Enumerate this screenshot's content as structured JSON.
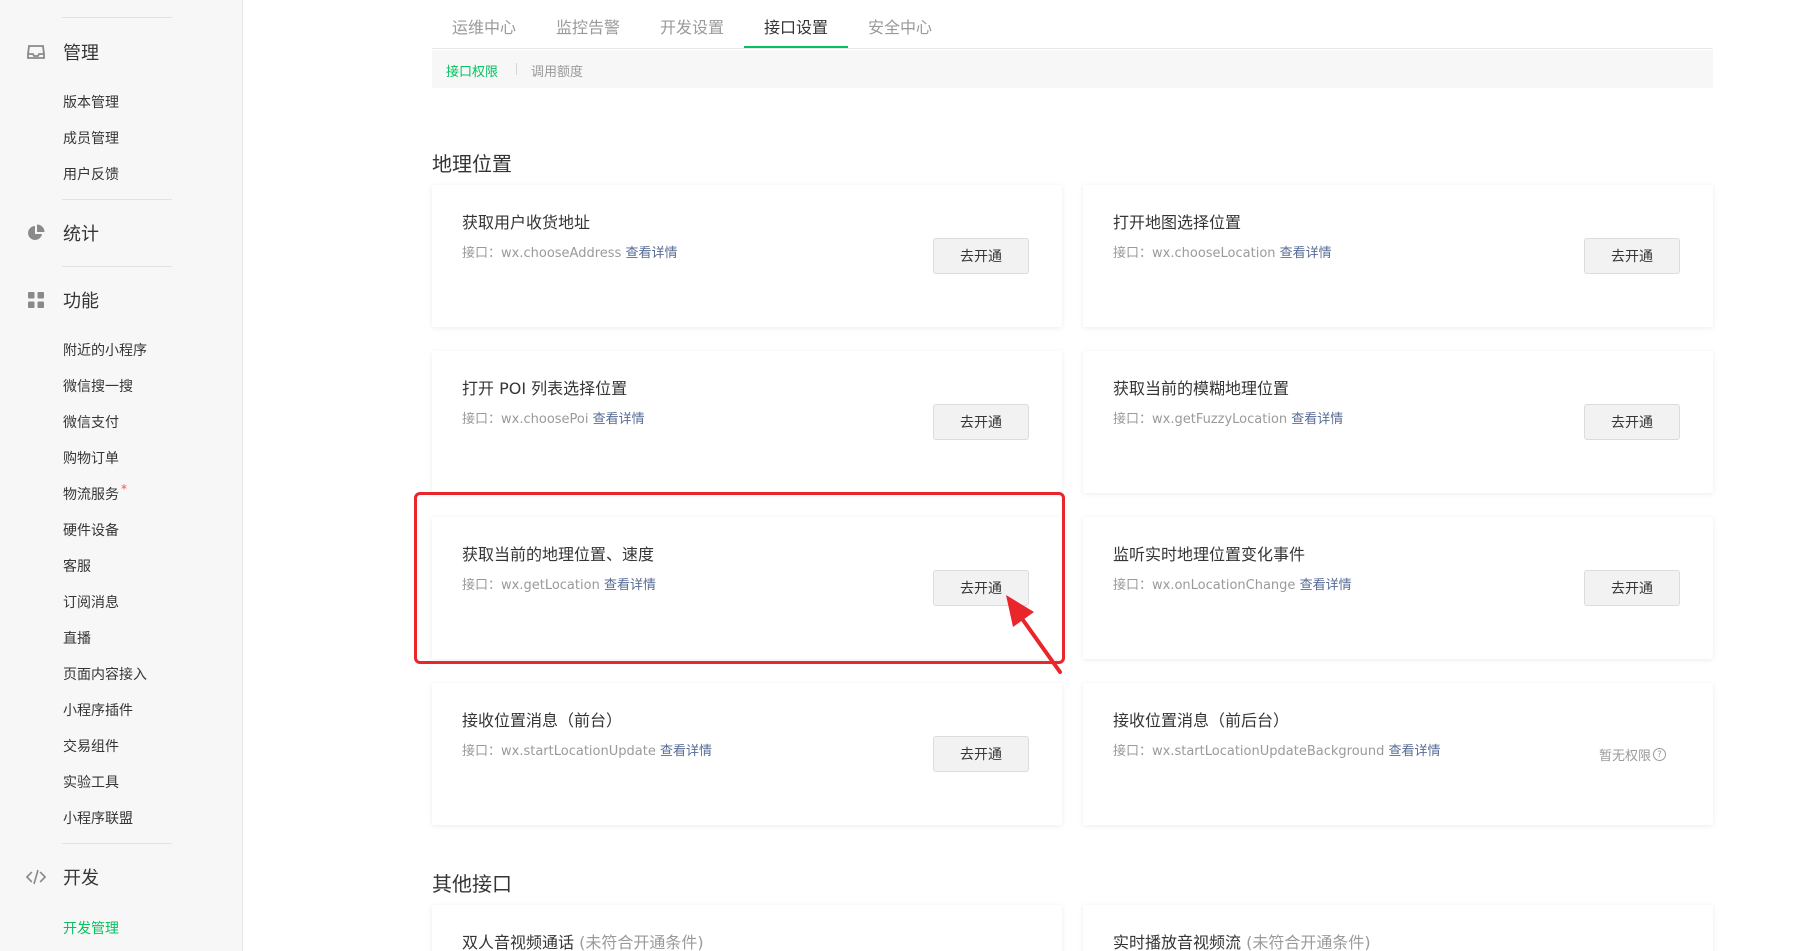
{
  "sidebar": {
    "groups": {
      "manage": {
        "title": "管理",
        "icon": "inbox-icon",
        "items": [
          "版本管理",
          "成员管理",
          "用户反馈"
        ]
      },
      "stats": {
        "title": "统计",
        "icon": "pie-chart-icon"
      },
      "features": {
        "title": "功能",
        "icon": "grid-icon",
        "items": [
          "附近的小程序",
          "微信搜一搜",
          "微信支付",
          "购物订单",
          "物流服务",
          "硬件设备",
          "客服",
          "订阅消息",
          "直播",
          "页面内容接入",
          "小程序插件",
          "交易组件",
          "实验工具",
          "小程序联盟"
        ],
        "dot_mark": "*"
      },
      "develop": {
        "title": "开发",
        "icon": "code-icon",
        "items": [
          "开发管理"
        ]
      }
    }
  },
  "tabs": [
    "运维中心",
    "监控告警",
    "开发设置",
    "接口设置",
    "安全中心"
  ],
  "active_tab": "接口设置",
  "subtabs": [
    "接口权限",
    "调用额度"
  ],
  "active_subtab": "接口权限",
  "sections": {
    "geo": {
      "title": "地理位置",
      "cards": [
        {
          "title": "获取用户收货地址",
          "api_prefix": "接口：",
          "api": "wx.chooseAddress",
          "detail": "查看详情",
          "action": "去开通"
        },
        {
          "title": "打开地图选择位置",
          "api_prefix": "接口：",
          "api": "wx.chooseLocation",
          "detail": "查看详情",
          "action": "去开通"
        },
        {
          "title": "打开 POI 列表选择位置",
          "api_prefix": "接口：",
          "api": "wx.choosePoi",
          "detail": "查看详情",
          "action": "去开通"
        },
        {
          "title": "获取当前的模糊地理位置",
          "api_prefix": "接口：",
          "api": "wx.getFuzzyLocation",
          "detail": "查看详情",
          "action": "去开通"
        },
        {
          "title": "获取当前的地理位置、速度",
          "api_prefix": "接口：",
          "api": "wx.getLocation",
          "detail": "查看详情",
          "action": "去开通"
        },
        {
          "title": "监听实时地理位置变化事件",
          "api_prefix": "接口：",
          "api": "wx.onLocationChange",
          "detail": "查看详情",
          "action": "去开通"
        },
        {
          "title": "接收位置消息（前台）",
          "api_prefix": "接口：",
          "api": "wx.startLocationUpdate",
          "detail": "查看详情",
          "action": "去开通"
        },
        {
          "title": "接收位置消息（前后台）",
          "api_prefix": "接口：",
          "api": "wx.startLocationUpdateBackground",
          "detail": "查看详情",
          "status": "暂无权限",
          "status_icon": "?"
        }
      ]
    },
    "other": {
      "title": "其他接口",
      "cards": [
        {
          "title": "双人音视频通话",
          "note": "(未符合开通条件)"
        },
        {
          "title": "实时播放音视频流",
          "note": "(未符合开通条件)"
        }
      ]
    }
  },
  "annotation": {
    "color": "#e8262b",
    "target": "wx.getLocation 去开通"
  },
  "colors": {
    "accent": "#07c160",
    "link": "#576b95",
    "muted": "#9a9a9a",
    "text": "#353535"
  }
}
